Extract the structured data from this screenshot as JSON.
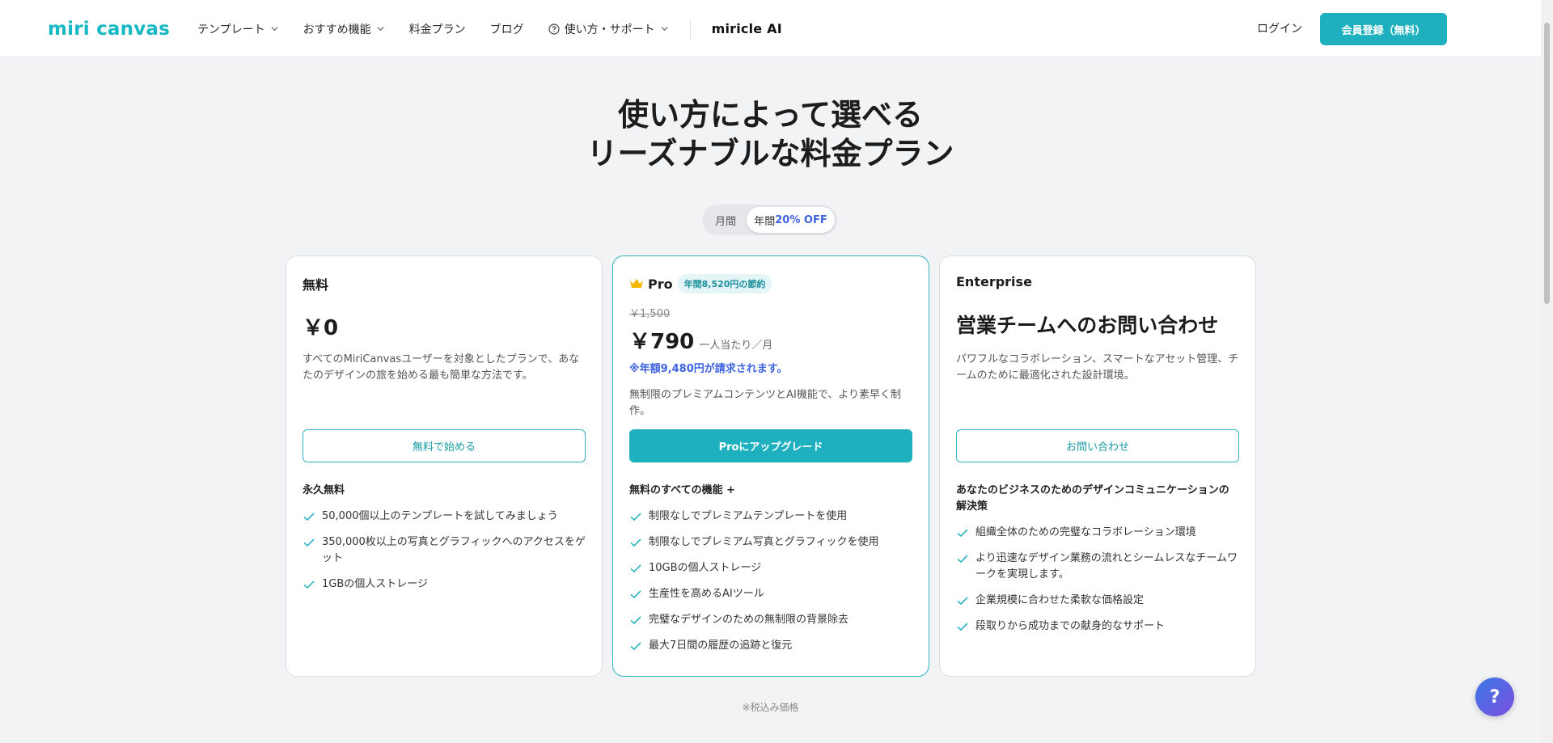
{
  "header": {
    "logo": "miri canvas",
    "nav": [
      {
        "label": "テンプレート",
        "has_dropdown": true
      },
      {
        "label": "おすすめ機能",
        "has_dropdown": true
      },
      {
        "label": "料金プラン",
        "has_dropdown": false
      },
      {
        "label": "ブログ",
        "has_dropdown": false
      },
      {
        "label": "使い方・サポート",
        "has_dropdown": true
      }
    ],
    "brand_ai": "miricle AI",
    "login": "ログイン",
    "signup": "会員登録（無料）"
  },
  "hero": {
    "title_line1": "使い方によって選べる",
    "title_line2": "リーズナブルな料金プラン"
  },
  "billing_toggle": {
    "monthly": "月間",
    "yearly": "年間",
    "yearly_discount": "20% OFF",
    "selected": "yearly"
  },
  "plans": {
    "free": {
      "name": "無料",
      "price": "￥0",
      "description": "すべてのMiriCanvasユーザーを対象としたプランで、あなたのデザインの旅を始める最も簡単な方法です。",
      "cta": "無料で始める",
      "features_heading": "永久無料",
      "features": [
        "50,000個以上のテンプレートを試してみましょう",
        "350,000枚以上の写真とグラフィックへのアクセスをゲット",
        "1GBの個人ストレージ"
      ]
    },
    "pro": {
      "name": "Pro",
      "badge": "年間8,520円の節約",
      "old_price": "￥1,500",
      "price": "￥790",
      "per_unit": "一人当たり／月",
      "billed_note": "※年額9,480円が請求されます。",
      "description": "無制限のプレミアムコンテンツとAI機能で、より素早く制作。",
      "cta": "Proにアップグレード",
      "features_heading": "無料のすべての機能 +",
      "features": [
        "制限なしでプレミアムテンプレートを使用",
        "制限なしでプレミアム写真とグラフィックを使用",
        "10GBの個人ストレージ",
        "生産性を高めるAIツール",
        "完璧なデザインのための無制限の背景除去",
        "最大7日間の履歴の追跡と復元"
      ]
    },
    "enterprise": {
      "name": "Enterprise",
      "title": "営業チームへのお問い合わせ",
      "description": "パワフルなコラボレーション、スマートなアセット管理、チームのために最適化された設計環境。",
      "cta": "お問い合わせ",
      "features_heading": "あなたのビジネスのためのデザインコミュニケーションの解決策",
      "features": [
        "組織全体のための完璧なコラボレーション環境",
        "より迅速なデザイン業務の流れとシームレスなチームワークを実現します。",
        "企業規模に合わせた柔軟な価格設定",
        "段取りから成功までの献身的なサポート"
      ]
    }
  },
  "tax_note": "※税込み価格",
  "chat_button": "?",
  "colors": {
    "brand": "#17b8c4",
    "accent_button": "#1fb0bf",
    "discount_blue": "#3f63e0",
    "background": "#f2f3f5"
  }
}
